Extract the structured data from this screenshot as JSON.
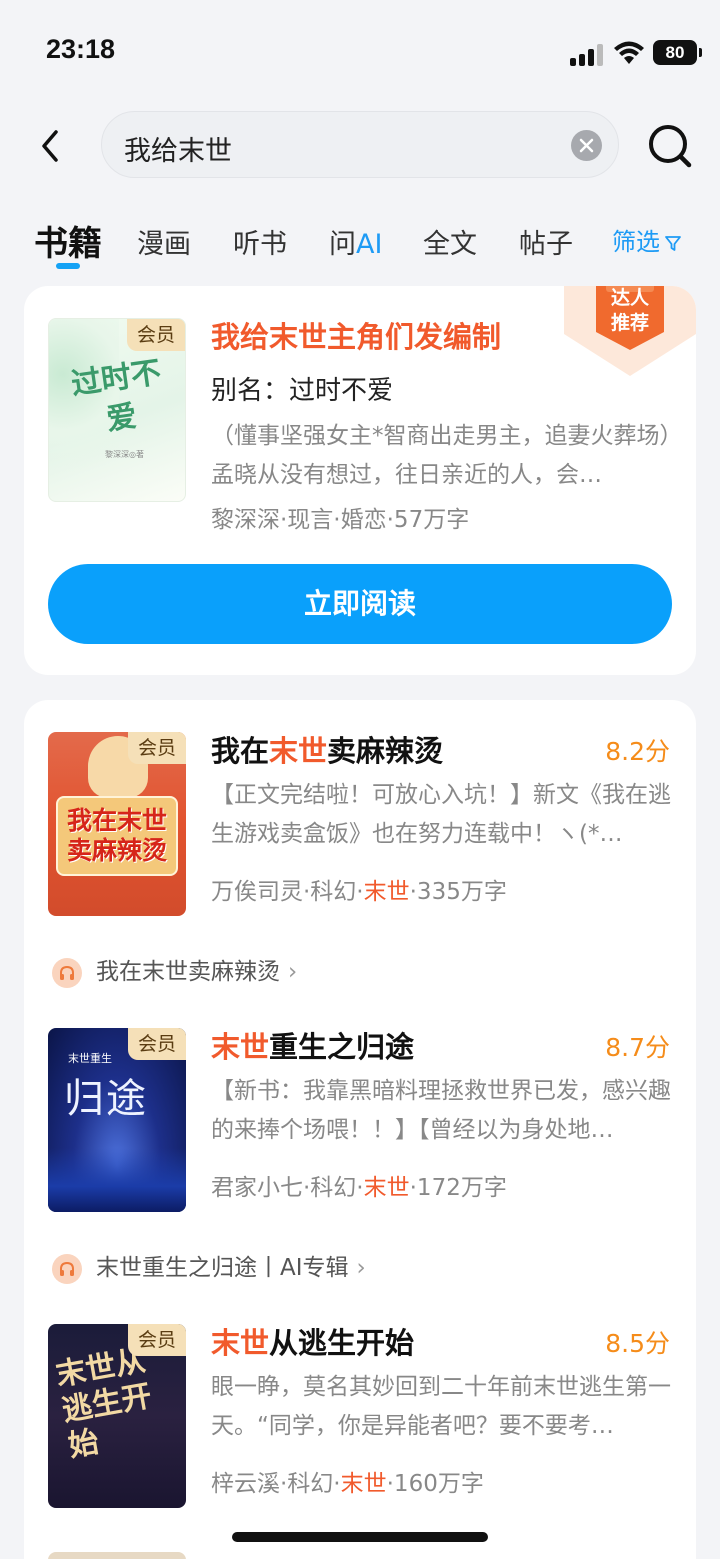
{
  "status": {
    "time": "23:18",
    "battery": "80"
  },
  "search": {
    "query": "我给末世"
  },
  "tabs": {
    "books": "书籍",
    "comics": "漫画",
    "audio": "听书",
    "ask_prefix": "问",
    "ask_ai": "AI",
    "fulltext": "全文",
    "posts": "帖子",
    "filter": "筛选"
  },
  "featured": {
    "cover_title": "过时不爱",
    "cover_author": "黎深深◎著",
    "badge": "会员",
    "title": "我给末世主角们发编制",
    "alias": "别名：过时不爱",
    "description": "（懂事坚强女主*智商出走男主，追妻火葬场）孟晓从没有想过，往日亲近的人，会…",
    "meta": "黎深深·现言·婚恋·57万字",
    "read_button": "立即阅读",
    "recommend_badge_line1": "达人",
    "recommend_badge_line2": "推荐"
  },
  "results": [
    {
      "badge": "会员",
      "cover_title": "我在末世卖麻辣烫",
      "title_pre": "我在",
      "title_hl": "末世",
      "title_post": "卖麻辣烫",
      "score": "8.2分",
      "description": "【正文完结啦！可放心入坑！】新文《我在逃生游戏卖盒饭》也在努力连载中！ヽ(*…",
      "meta_pre": "万俟司灵·科幻·",
      "meta_hl": "末世",
      "meta_post": "·335万字",
      "audio": "我在末世卖麻辣烫"
    },
    {
      "badge": "会员",
      "cover_title": "归途",
      "cover_sub": "末世重生",
      "title_pre": "",
      "title_hl": "末世",
      "title_post": "重生之归途",
      "score": "8.7分",
      "description": "【新书：我靠黑暗料理拯救世界已发，感兴趣的来捧个场喂！！】【曾经以为身处地…",
      "meta_pre": "君家小七·科幻·",
      "meta_hl": "末世",
      "meta_post": "·172万字",
      "audio": "末世重生之归途丨AI专辑"
    },
    {
      "badge": "会员",
      "cover_title": "末世从逃生开始",
      "title_pre": "",
      "title_hl": "末世",
      "title_post": "从逃生开始",
      "score": "8.5分",
      "description": "眼一睁，莫名其妙回到二十年前末世逃生第一天。“同学，你是异能者吧？要不要考…",
      "meta_pre": "梓云溪·科幻·",
      "meta_hl": "末世",
      "meta_post": "·160万字"
    }
  ],
  "colors": {
    "accent": "#0aa0fb",
    "highlight": "#f15a2c",
    "score": "#f58c1a",
    "vip_badge": "#f5e0b8"
  }
}
